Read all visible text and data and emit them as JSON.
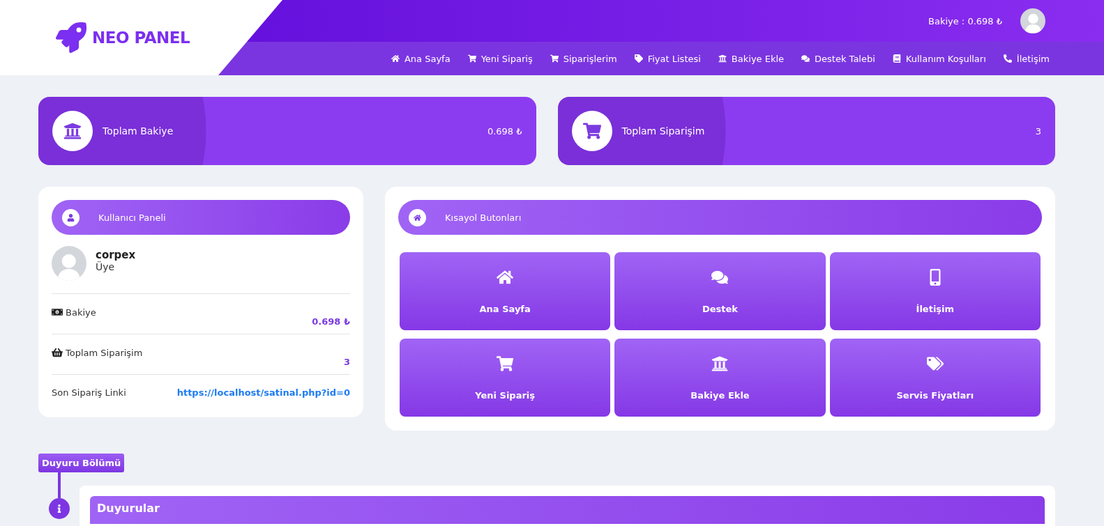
{
  "brand": {
    "name": "NEO PANEL"
  },
  "header": {
    "balance": "Bakiye : 0.698 ₺"
  },
  "nav": [
    {
      "label": "Ana Sayfa"
    },
    {
      "label": "Yeni Sipariş"
    },
    {
      "label": "Siparişlerim"
    },
    {
      "label": "Fiyat Listesi"
    },
    {
      "label": "Bakiye Ekle"
    },
    {
      "label": "Destek Talebi"
    },
    {
      "label": "Kullanım Koşulları"
    },
    {
      "label": "İletişim"
    }
  ],
  "stats": [
    {
      "label": "Toplam Bakiye",
      "value": "0.698 ₺"
    },
    {
      "label": "Toplam Siparişim",
      "value": "3"
    }
  ],
  "user_panel": {
    "title": "Kullanıcı Paneli",
    "username": "corpex",
    "role": "Üye",
    "rows": [
      {
        "label": "Bakiye",
        "value": "0.698 ₺",
        "kind": "value"
      },
      {
        "label": "Toplam Siparişim",
        "value": "3",
        "kind": "value"
      },
      {
        "label": "Son Sipariş Linki",
        "value": "https://localhost/satinal.php?id=0",
        "kind": "link"
      }
    ]
  },
  "shortcuts": {
    "title": "Kısayol Butonları",
    "buttons": [
      {
        "label": "Ana Sayfa"
      },
      {
        "label": "Destek"
      },
      {
        "label": "İletişim"
      },
      {
        "label": "Yeni Sipariş"
      },
      {
        "label": "Bakiye Ekle"
      },
      {
        "label": "Servis Fiyatları"
      }
    ]
  },
  "announcements": {
    "section_label": "Duyuru Bölümü",
    "title": "Duyurular"
  }
}
